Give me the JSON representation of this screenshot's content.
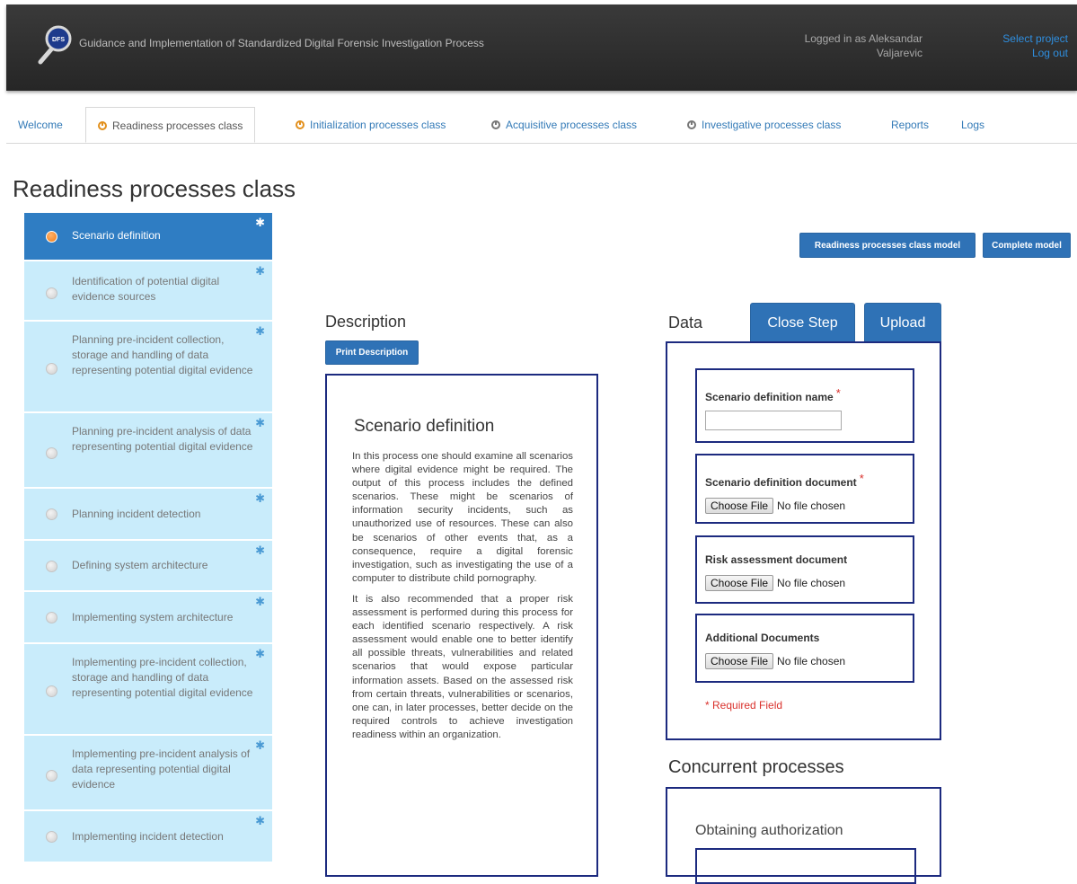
{
  "header": {
    "logo_text": "DFS",
    "title": "Guidance and Implementation of Standardized Digital Forensic Investigation Process",
    "user_line1": "Logged in as Aleksandar",
    "user_line2": "Valjarevic",
    "select_project": "Select project",
    "logout": "Log out"
  },
  "tabs": [
    {
      "label": "Welcome"
    },
    {
      "label": "Readiness processes class"
    },
    {
      "label": "Initialization processes class"
    },
    {
      "label": "Acquisitive processes class"
    },
    {
      "label": "Investigative processes class"
    },
    {
      "label": "Reports"
    },
    {
      "label": "Logs"
    }
  ],
  "page_title": "Readiness processes class",
  "sidebar": {
    "items": [
      {
        "label": "Scenario definition"
      },
      {
        "label": "Identification of potential digital evidence sources"
      },
      {
        "label": "Planning pre-incident collection, storage and handling of data representing potential digital evidence"
      },
      {
        "label": "Planning pre-incident analysis of data representing potential digital evidence"
      },
      {
        "label": "Planning incident detection"
      },
      {
        "label": "Defining system architecture"
      },
      {
        "label": "Implementing system architecture"
      },
      {
        "label": "Implementing pre-incident collection, storage and handling of data representing potential digital evidence"
      },
      {
        "label": "Implementing pre-incident analysis of data representing potential digital evidence"
      },
      {
        "label": "Implementing incident detection"
      }
    ]
  },
  "buttons": {
    "model": "Readiness processes class model",
    "complete": "Complete model",
    "print": "Print Description",
    "close_step": "Close Step",
    "upload": "Upload"
  },
  "description": {
    "heading": "Description",
    "title": "Scenario definition",
    "p1": "In this process one should examine all scenarios where digital evidence might be required. The output of this process includes the defined scenarios. These might be scenarios of information security incidents, such as unauthorized use of resources. These can also be scenarios of other events that, as a consequence, require a digital forensic investigation, such as investigating the use of a computer to distribute child pornography.",
    "p2": "It is also recommended that a proper risk assessment is performed during this process for each identified scenario respectively. A risk assessment would enable one to better identify all possible threats, vulnerabilities and related scenarios that would expose particular information assets. Based on the assessed risk from certain threats, vulnerabilities or scenarios, one can, in later processes, better decide on the required controls to achieve investigation readiness within an organization."
  },
  "data_panel": {
    "heading": "Data",
    "fields": {
      "name_label": "Scenario definition name",
      "doc_label": "Scenario definition document",
      "risk_label": "Risk assessment document",
      "additional_label": "Additional Documents"
    },
    "required_mark": "*",
    "choose_file": "Choose File",
    "no_file": "No file chosen",
    "required_note": "* Required Field"
  },
  "concurrent": {
    "heading": "Concurrent processes",
    "item": "Obtaining authorization"
  },
  "colors": {
    "accent": "#2f72b6",
    "sidebar_bg": "#c9ecfb",
    "sidebar_active": "#2f7dc3",
    "border_navy": "#1c2a7f",
    "required": "#d9302b",
    "tab_icon": "#e2901d"
  }
}
